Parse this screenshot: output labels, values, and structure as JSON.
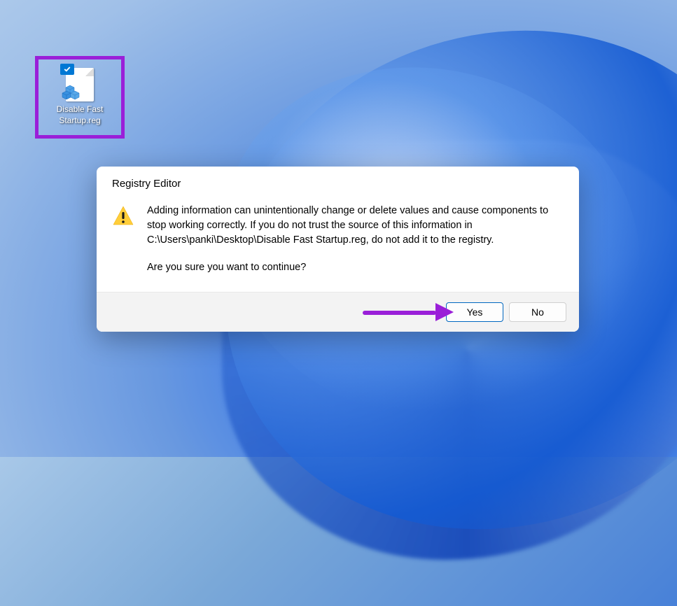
{
  "desktop": {
    "icon_label": "Disable Fast Startup.reg"
  },
  "dialog": {
    "title": "Registry Editor",
    "message_line1": "Adding information can unintentionally change or delete values and cause components to stop working correctly. If you do not trust the source of this information in C:\\Users\\panki\\Desktop\\Disable Fast Startup.reg, do not add it to the registry.",
    "confirm_line": "Are you sure you want to continue?",
    "yes_label": "Yes",
    "no_label": "No"
  },
  "annotations": {
    "highlight_color": "#9a1fd8"
  }
}
